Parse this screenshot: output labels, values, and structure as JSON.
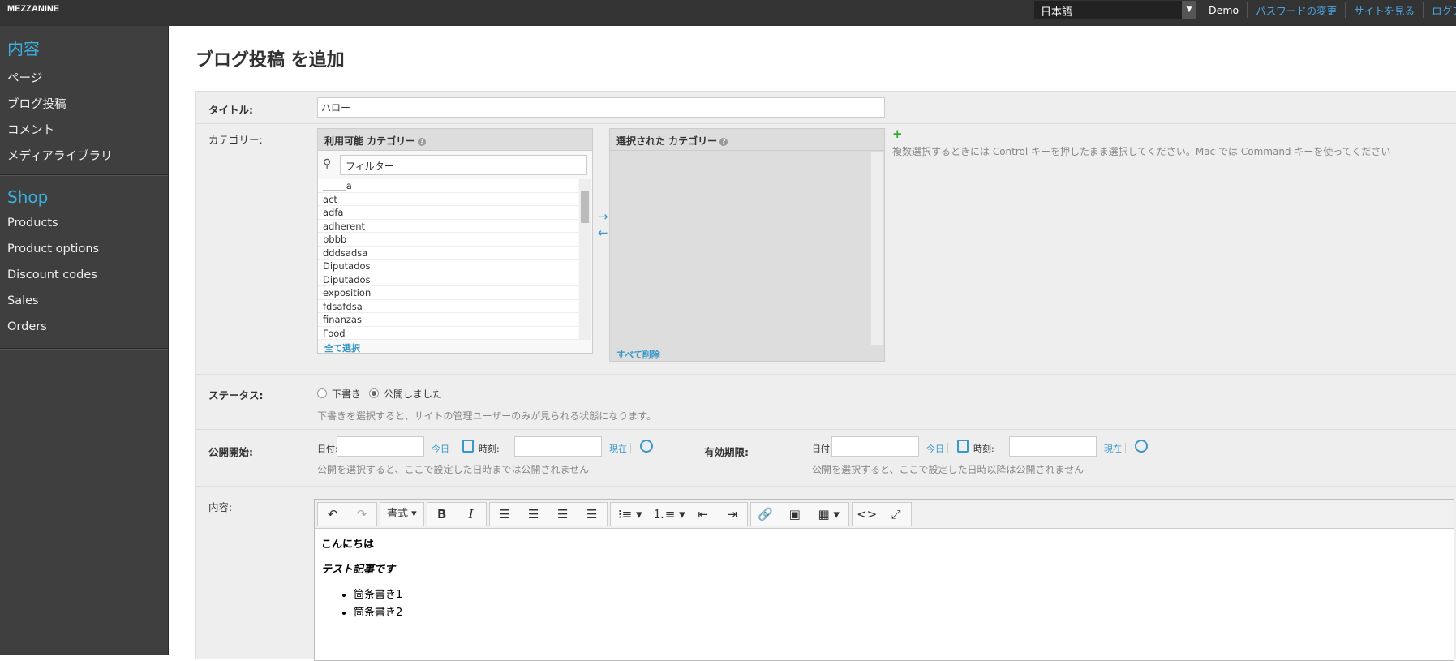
{
  "topbar": {
    "brand": "MEZZANINE",
    "language": "日本語",
    "user": "Demo",
    "links": [
      "パスワードの変更",
      "サイトを見る",
      "ログア"
    ]
  },
  "sidebar": {
    "sections": [
      {
        "title": "内容",
        "items": [
          "ページ",
          "ブログ投稿",
          "コメント",
          "メディアライブラリ"
        ]
      },
      {
        "title": "Shop",
        "items": [
          "Products",
          "Product options",
          "Discount codes",
          "Sales",
          "Orders"
        ]
      }
    ]
  },
  "page": {
    "title": "ブログ投稿 を追加"
  },
  "form": {
    "title_label": "タイトル:",
    "title_value": "ハロー",
    "category_label": "カテゴリー:",
    "available_header": "利用可能 カテゴリー",
    "filter_placeholder": "フィルター",
    "available_options": [
      "_____a",
      "act",
      "adfa",
      "adherent",
      "bbbb",
      "dddsadsa",
      "Diputados",
      "Diputados",
      "exposition",
      "fdsafdsa",
      "finanzas",
      "Food"
    ],
    "select_all": "全て選択",
    "chosen_header": "選択された カテゴリー",
    "remove_all": "すべて削除",
    "category_help": "複数選択するときには Control キーを押したまま選択してください。Mac では Command キーを使ってください",
    "status_label": "ステータス:",
    "status_options": [
      "下書き",
      "公開しました"
    ],
    "status_selected": "公開しました",
    "status_help": "下書きを選択すると、サイトの管理ユーザーのみが見られる状態になります。",
    "publish_label": "公開開始:",
    "expiry_label": "有効期限:",
    "date_label": "日付:",
    "today": "今日",
    "time_label": "時刻:",
    "now": "現在",
    "publish_help": "公開を選択すると、ここで設定した日時までは公開されません",
    "expiry_help": "公開を選択すると、ここで設定した日時以降は公開されません",
    "content_label": "内容:"
  },
  "editor": {
    "format_label": "書式",
    "paragraph1": "こんにちは",
    "paragraph2": "テスト記事です",
    "bullets": [
      "箇条書き1",
      "箇条書き2"
    ]
  }
}
